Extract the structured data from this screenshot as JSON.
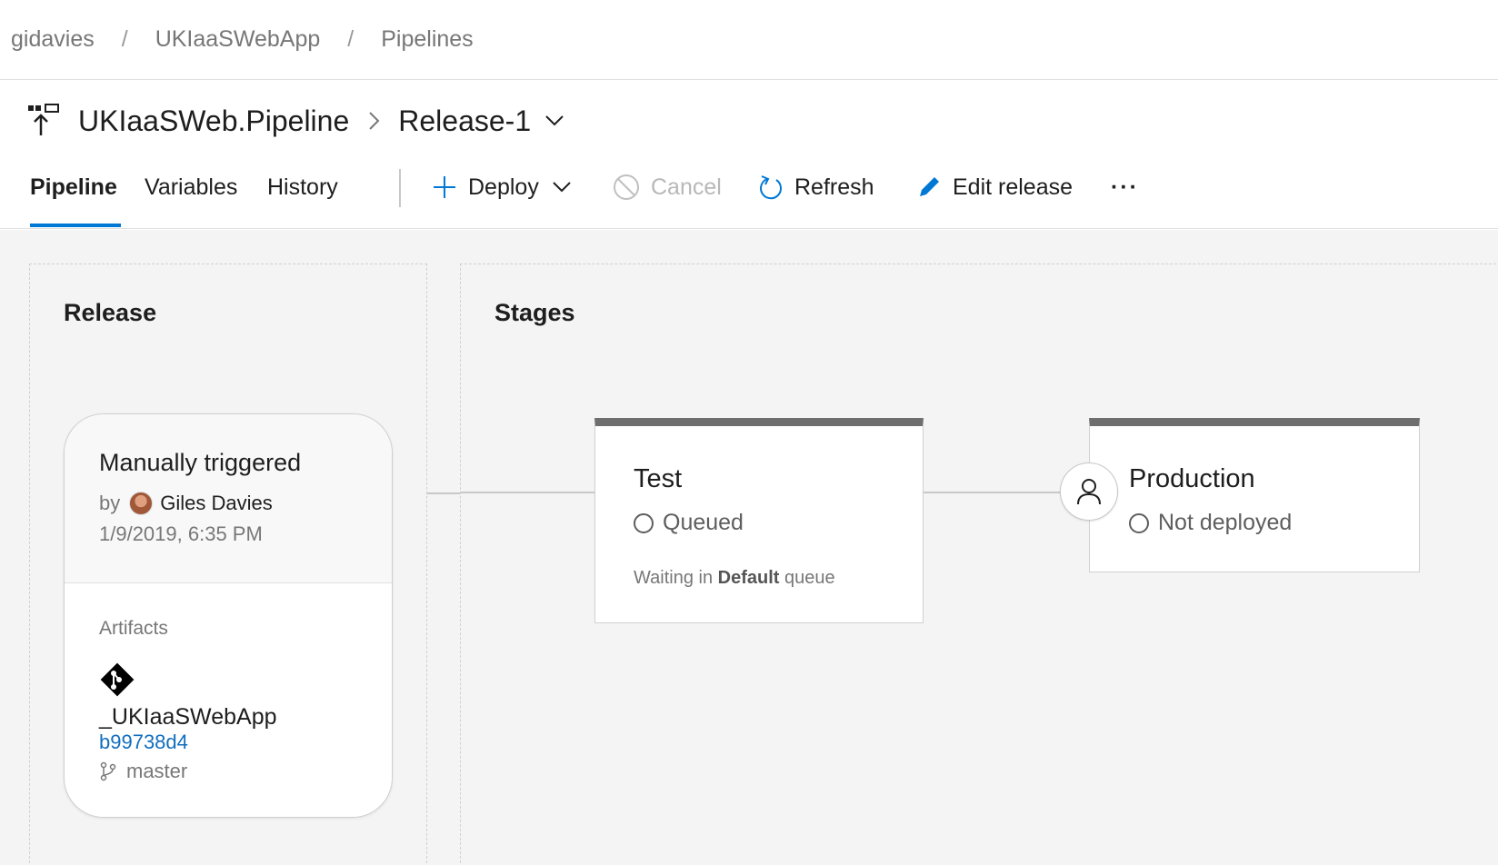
{
  "breadcrumb": {
    "items": [
      "gidavies",
      "UKIaaSWebApp",
      "Pipelines"
    ],
    "separator": "/"
  },
  "title": {
    "pipeline_name": "UKIaaSWeb.Pipeline",
    "release_name": "Release-1"
  },
  "tabs": [
    {
      "label": "Pipeline",
      "active": true
    },
    {
      "label": "Variables",
      "active": false
    },
    {
      "label": "History",
      "active": false
    }
  ],
  "toolbar": {
    "deploy_label": "Deploy",
    "cancel_label": "Cancel",
    "refresh_label": "Refresh",
    "edit_label": "Edit release",
    "more_label": "···"
  },
  "release_panel": {
    "title": "Release",
    "trigger": "Manually triggered",
    "by_label": "by",
    "user": "Giles Davies",
    "date": "1/9/2019, 6:35 PM",
    "artifacts_label": "Artifacts",
    "artifact_name": "_UKIaaSWebApp",
    "commit": "b99738d4",
    "branch": "master"
  },
  "stages_panel": {
    "title": "Stages",
    "stages": [
      {
        "name": "Test",
        "status": "Queued",
        "note_prefix": "Waiting in",
        "note_queue": "Default",
        "note_suffix": "queue"
      },
      {
        "name": "Production",
        "status": "Not deployed"
      }
    ]
  },
  "colors": {
    "accent": "#0078d4",
    "link": "#106ebe",
    "stage_bar": "#6e6e6e",
    "canvas_bg": "#f4f4f4"
  }
}
